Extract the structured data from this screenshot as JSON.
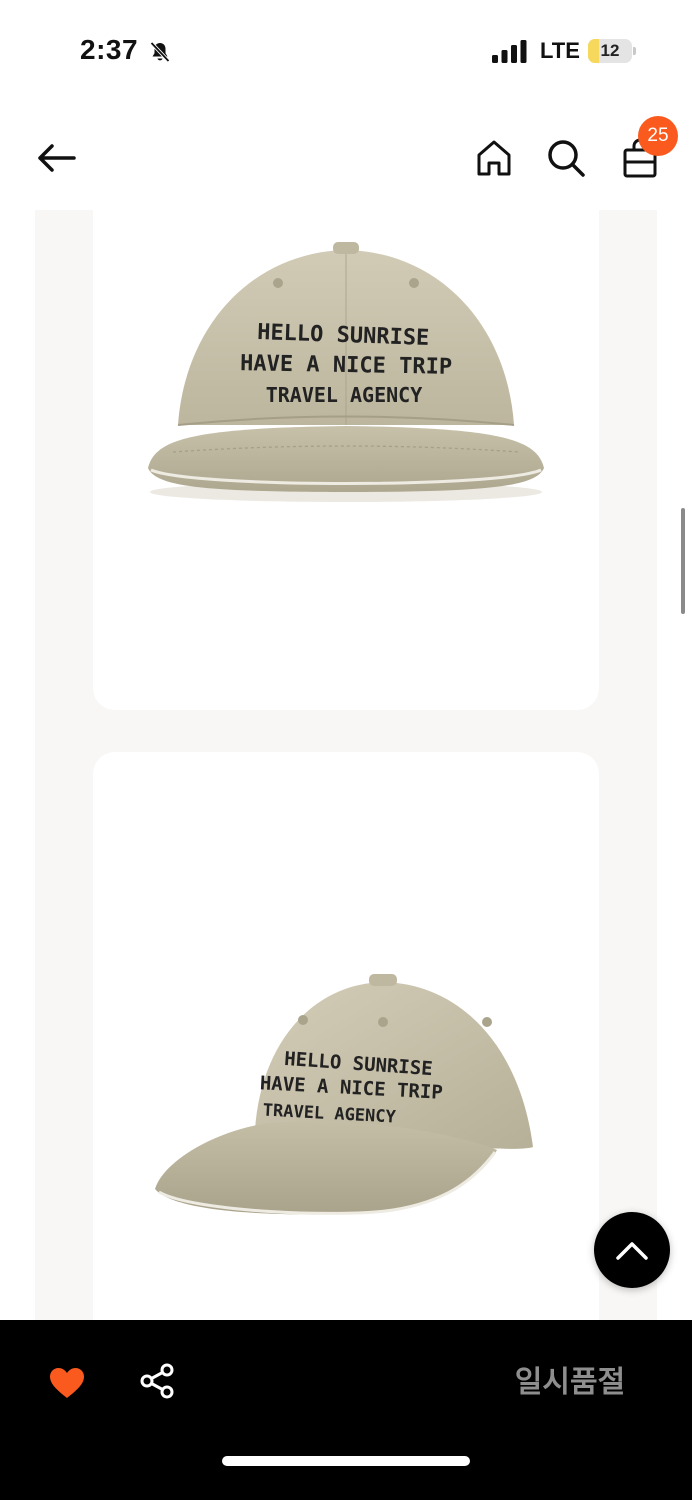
{
  "status_bar": {
    "time": "2:37",
    "network": "LTE",
    "battery_level": "12",
    "battery_fraction": 0.12,
    "battery_color": "#f6d85c"
  },
  "nav": {
    "cart_count": "25",
    "badge_color": "#fa5a1e"
  },
  "product_images": [
    {
      "cap_lines": [
        "HELLO SUNRISE",
        "HAVE A NICE TRIP",
        "TRAVEL AGENCY"
      ],
      "view": "front"
    },
    {
      "cap_lines": [
        "HELLO SUNRISE",
        "HAVE A NICE TRIP",
        "TRAVEL AGENCY"
      ],
      "view": "three-quarter"
    }
  ],
  "bottom_bar": {
    "soldout_label": "일시품절",
    "heart_color": "#fa5a1e"
  },
  "icons": [
    "bell-off-icon",
    "signal-icon",
    "battery-icon",
    "back-arrow-icon",
    "home-icon",
    "search-icon",
    "shopping-bag-icon",
    "chevron-up-icon",
    "heart-icon",
    "share-icon"
  ]
}
